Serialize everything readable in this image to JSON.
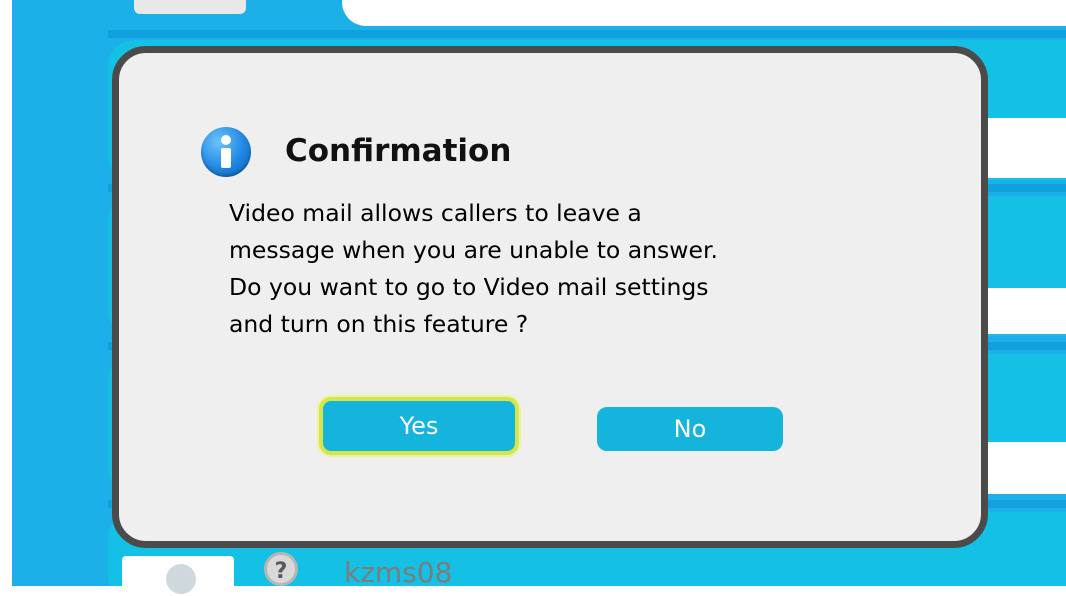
{
  "dialog": {
    "title": "Confirmation",
    "icon": "info-icon",
    "message_lines": [
      "Video mail allows callers to leave a",
      "message when you are unable to answer.",
      "Do you want to go to Video mail settings",
      "and turn on this feature ?"
    ],
    "yes_label": "Yes",
    "no_label": "No",
    "focused_button": "Yes"
  },
  "contact_list": {
    "visible_contact": {
      "name": "kzms08",
      "status_icon": "question-mark-icon",
      "status_symbol": "?"
    }
  },
  "colors": {
    "background": "#1cb0e8",
    "dialog_background": "#efefef",
    "dialog_border": "#4b4b4b",
    "button": "#14b4dc",
    "focus_ring": "#d6e64a",
    "info_icon": "#1f86e0"
  }
}
